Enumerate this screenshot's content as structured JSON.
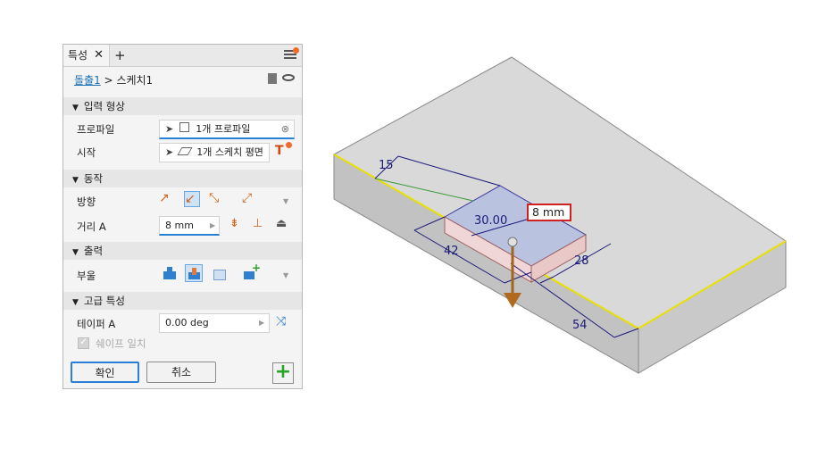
{
  "panel": {
    "tab_label": "특성",
    "tab_close": "✕",
    "tab_add": "+",
    "breadcrumb": {
      "parent": "돌출1",
      "separator": ">",
      "current": "스케치1"
    },
    "sections": {
      "input": "입력 형상",
      "behavior": "동작",
      "output": "출력",
      "advanced": "고급 특성"
    },
    "profile": {
      "label": "프로파일",
      "value": "1개 프로파일"
    },
    "start": {
      "label": "시작",
      "value": "1개 스케치 평면"
    },
    "direction": {
      "label": "방향"
    },
    "distance": {
      "label": "거리 A",
      "value": "8 mm"
    },
    "boolean": {
      "label": "부울"
    },
    "taper": {
      "label": "테이퍼 A",
      "value": "0.00 deg"
    },
    "match_shape": {
      "label": "쉐이프 일치",
      "checked": true
    },
    "buttons": {
      "ok": "확인",
      "cancel": "취소",
      "add": "+"
    }
  },
  "viewport": {
    "callout_value": "8 mm",
    "dims": {
      "d15": "15",
      "d30": "30.00",
      "d42": "42",
      "d28": "28",
      "d54": "54"
    }
  },
  "colors": {
    "accent": "#2a7fd4",
    "notify": "#f26a2a",
    "edge_highlight": "#e8e000",
    "dimension": "#1b1b7a"
  }
}
